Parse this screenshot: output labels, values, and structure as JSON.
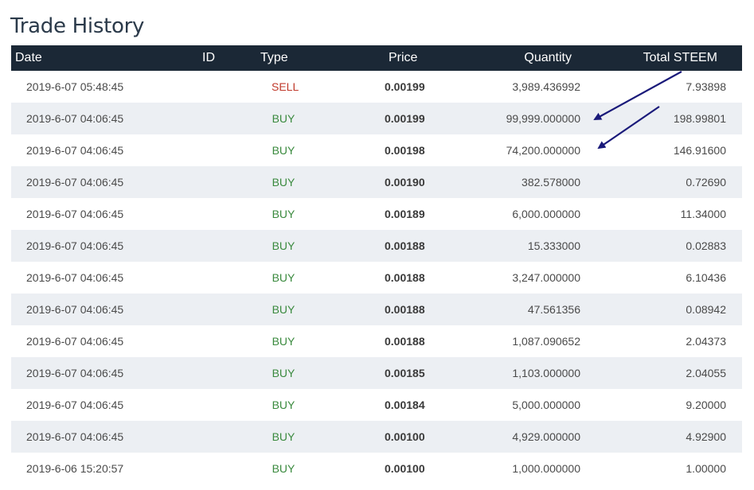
{
  "page": {
    "title": "Trade History"
  },
  "table": {
    "headers": {
      "date": "Date",
      "id": "ID",
      "type": "Type",
      "price": "Price",
      "quantity": "Quantity",
      "total": "Total STEEM"
    },
    "rows": [
      {
        "date": "2019-6-07 05:48:45",
        "type": "SELL",
        "price": "0.00199",
        "quantity": "3,989.436992",
        "total": "7.93898"
      },
      {
        "date": "2019-6-07 04:06:45",
        "type": "BUY",
        "price": "0.00199",
        "quantity": "99,999.000000",
        "total": "198.99801"
      },
      {
        "date": "2019-6-07 04:06:45",
        "type": "BUY",
        "price": "0.00198",
        "quantity": "74,200.000000",
        "total": "146.91600"
      },
      {
        "date": "2019-6-07 04:06:45",
        "type": "BUY",
        "price": "0.00190",
        "quantity": "382.578000",
        "total": "0.72690"
      },
      {
        "date": "2019-6-07 04:06:45",
        "type": "BUY",
        "price": "0.00189",
        "quantity": "6,000.000000",
        "total": "11.34000"
      },
      {
        "date": "2019-6-07 04:06:45",
        "type": "BUY",
        "price": "0.00188",
        "quantity": "15.333000",
        "total": "0.02883"
      },
      {
        "date": "2019-6-07 04:06:45",
        "type": "BUY",
        "price": "0.00188",
        "quantity": "3,247.000000",
        "total": "6.10436"
      },
      {
        "date": "2019-6-07 04:06:45",
        "type": "BUY",
        "price": "0.00188",
        "quantity": "47.561356",
        "total": "0.08942"
      },
      {
        "date": "2019-6-07 04:06:45",
        "type": "BUY",
        "price": "0.00188",
        "quantity": "1,087.090652",
        "total": "2.04373"
      },
      {
        "date": "2019-6-07 04:06:45",
        "type": "BUY",
        "price": "0.00185",
        "quantity": "1,103.000000",
        "total": "2.04055"
      },
      {
        "date": "2019-6-07 04:06:45",
        "type": "BUY",
        "price": "0.00184",
        "quantity": "5,000.000000",
        "total": "9.20000"
      },
      {
        "date": "2019-6-07 04:06:45",
        "type": "BUY",
        "price": "0.00100",
        "quantity": "4,929.000000",
        "total": "4.92900"
      },
      {
        "date": "2019-6-06 15:20:57",
        "type": "BUY",
        "price": "0.00100",
        "quantity": "1,000.000000",
        "total": "1.00000"
      }
    ]
  },
  "colors": {
    "header_bg": "#1b2836",
    "sell": "#c0392b",
    "buy": "#3a8a3e",
    "stripe": "#eceff3",
    "annotation_arrow": "#1a1a7a"
  },
  "annotations": {
    "arrows": [
      {
        "icon": "arrow-icon",
        "points_to": "row 2 quantity"
      },
      {
        "icon": "arrow-icon",
        "points_to": "row 3 quantity"
      }
    ]
  }
}
